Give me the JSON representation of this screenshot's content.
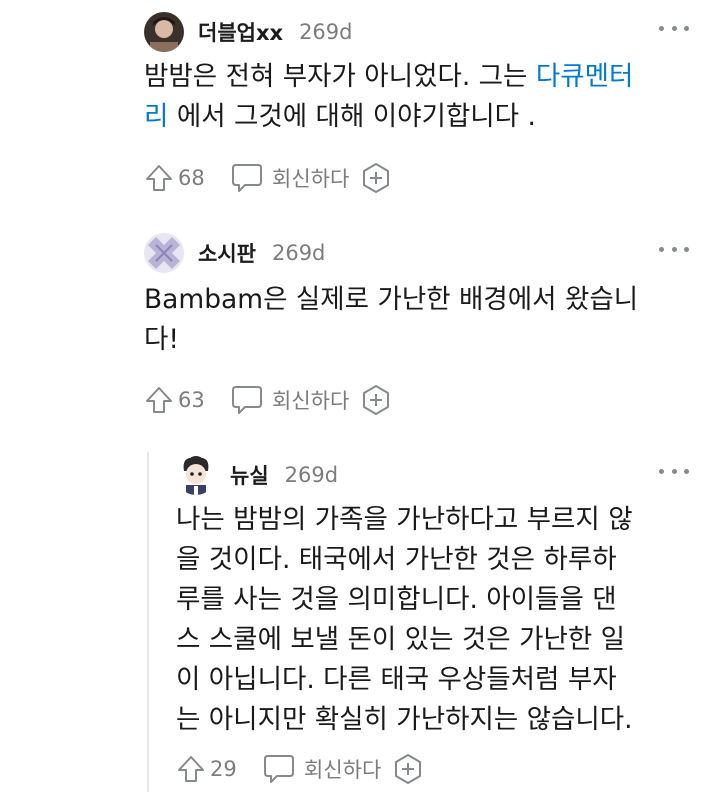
{
  "comments": [
    {
      "username": "더블업xx",
      "age": "269d",
      "body_parts": [
        "밤밤은 전혀 부자가 아니었다. 그는 ",
        "다큐멘터",
        "리",
        " 에서 그것에 대해 이야기합니다 ."
      ],
      "link_text": "다큐멘터리",
      "upvotes": "68",
      "reply_label": "회신하다"
    },
    {
      "username": "소시판",
      "age": "269d",
      "body_lines": [
        "Bambam은 실제로 가난한 배경에서 왔습니",
        "다!"
      ],
      "upvotes": "63",
      "reply_label": "회신하다"
    },
    {
      "username": "뉴실",
      "age": "269d",
      "body_lines": [
        "나는 밤밤의 가족을 가난하다고 부르지 않",
        "을 것이다. 태국에서 가난한 것은 하루하",
        "루를 사는 것을 의미합니다. 아이들을 댄",
        "스 스쿨에 보낼 돈이 있는 것은 가난한 일",
        "이 아닙니다. 다른 태국 우상들처럼 부자",
        "는 아니지만 확실히 가난하지는 않습니다."
      ],
      "upvotes": "29",
      "reply_label": "회신하다"
    }
  ],
  "colors": {
    "link": "#0079d3",
    "meta": "#7c7c7c",
    "text": "#1a1a1b"
  },
  "icons": [
    "upvote-arrow-icon",
    "speech-bubble-icon",
    "add-award-icon",
    "more-options-icon"
  ]
}
